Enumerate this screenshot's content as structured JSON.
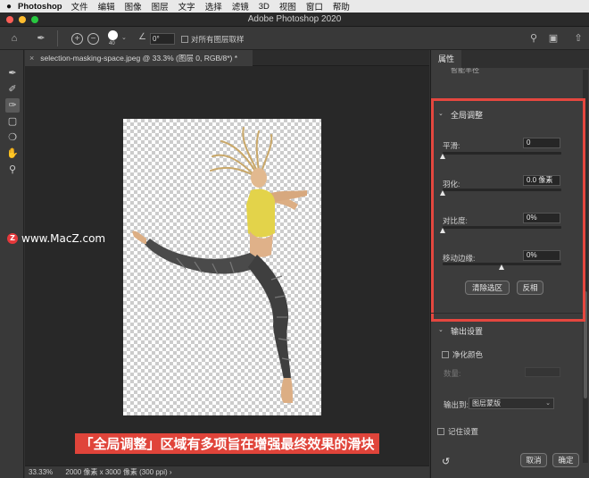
{
  "menubar": {
    "app": "Photoshop",
    "items": [
      "文件",
      "编辑",
      "图像",
      "图层",
      "文字",
      "选择",
      "滤镜",
      "3D",
      "视图",
      "窗口",
      "帮助"
    ]
  },
  "window": {
    "title": "Adobe Photoshop 2020"
  },
  "options": {
    "brush_size": "40",
    "angle_value": "0°",
    "sample_all_layers": "对所有图层取样"
  },
  "document": {
    "tab_title": "selection-masking-space.jpeg @ 33.3% (图层 0, RGB/8*) *"
  },
  "status": {
    "zoom": "33.33%",
    "dims": "2000 像素 x 3000 像素 (300 ppi)",
    "arrow": "›"
  },
  "watermark": {
    "text": "www.MacZ.com",
    "logo": "Z"
  },
  "caption": "「全局调整」区域有多项旨在增强最终效果的滑块",
  "panel": {
    "title": "属性",
    "cut_label": "智能半径",
    "global": {
      "header": "全局调整",
      "sliders": [
        {
          "label": "平滑:",
          "value": "0",
          "level": 0
        },
        {
          "label": "羽化:",
          "value": "0.0 像素",
          "level": 0
        },
        {
          "label": "对比度:",
          "value": "0%",
          "level": 0
        },
        {
          "label": "移动边缘:",
          "value": "0%",
          "level": 0.5
        }
      ],
      "clear_button": "清除选区",
      "invert_button": "反相"
    },
    "output": {
      "header": "输出设置",
      "decontaminate": "净化颜色",
      "amount_label": "数量:",
      "output_to_label": "输出到:",
      "output_to_value": "图层蒙版",
      "remember": "记住设置"
    },
    "cancel_button": "取消",
    "ok_button": "确定"
  }
}
